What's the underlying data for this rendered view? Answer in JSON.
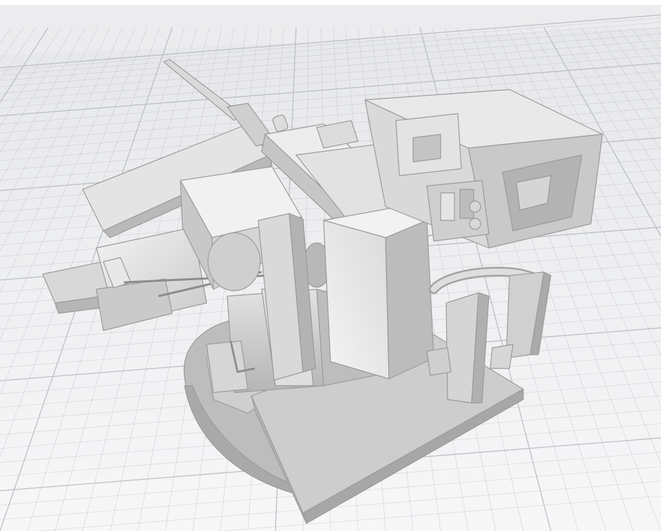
{
  "scene": {
    "background_color": "#ececee",
    "grid_color": "#b9bcc2",
    "model_color": "#d2d2d2",
    "model_highlight": "#efefef",
    "model_shadow": "#a8a8a8"
  }
}
